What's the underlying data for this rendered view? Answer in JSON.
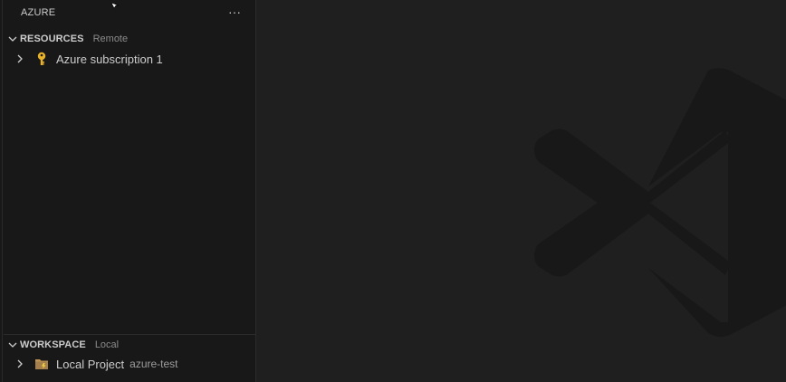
{
  "sidebar": {
    "title": "AZURE",
    "more_label": "···",
    "resources": {
      "title": "RESOURCES",
      "subtitle": "Remote",
      "items": [
        {
          "label": "Azure subscription 1",
          "icon": "key-icon"
        }
      ]
    },
    "workspace": {
      "title": "WORKSPACE",
      "subtitle": "Local",
      "items": [
        {
          "label": "Local Project",
          "description": "azure-test",
          "icon": "folder-function-icon"
        }
      ]
    }
  },
  "colors": {
    "sidebar_bg": "#181818",
    "editor_bg": "#1f1f1f",
    "key_icon": "#e8b22a",
    "folder_icon": "#c09553",
    "watermark": "#181818"
  },
  "editor": {
    "watermark": "vscode-logo-watermark"
  }
}
